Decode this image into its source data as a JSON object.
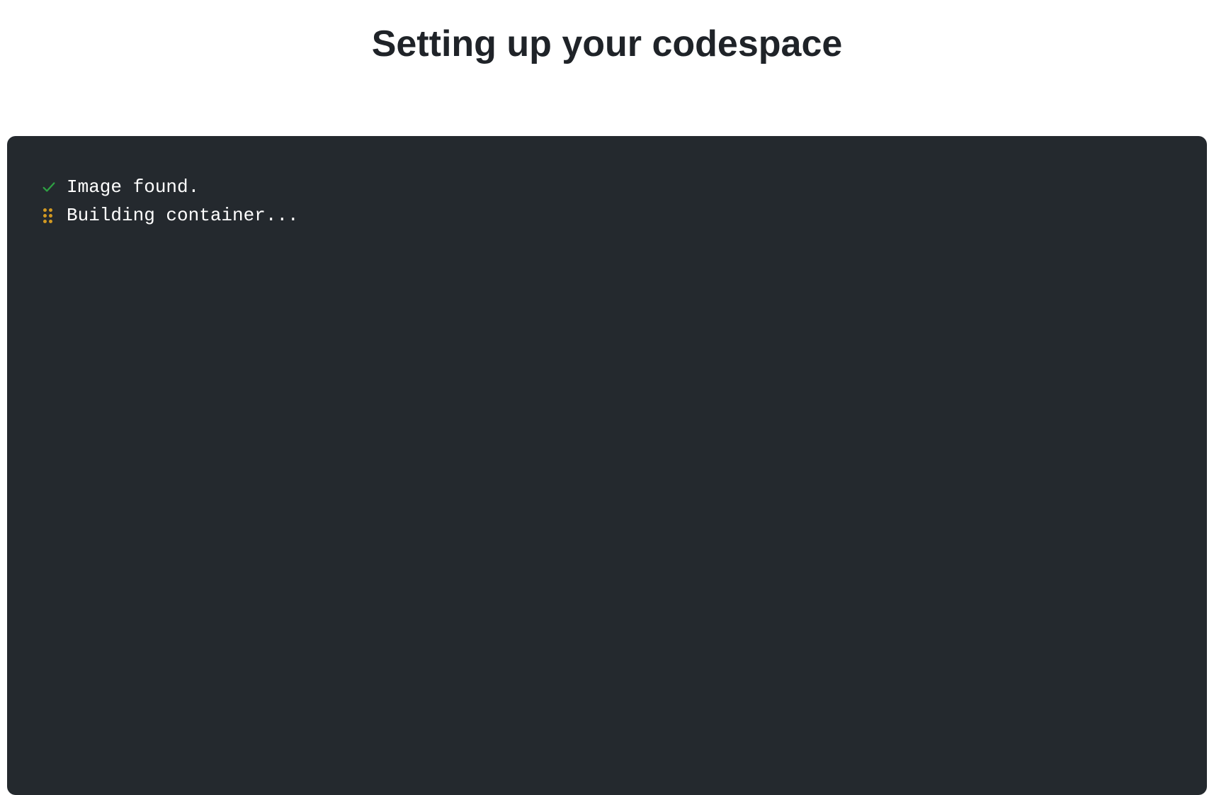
{
  "header": {
    "title": "Setting up your codespace"
  },
  "terminal": {
    "lines": [
      {
        "icon": "checkmark-icon",
        "text": "Image found."
      },
      {
        "icon": "spinner-icon",
        "text": "Building container..."
      }
    ]
  },
  "colors": {
    "success": "#2ea043",
    "pending": "#d29922",
    "terminal_bg": "#24292e",
    "text": "#ffffff"
  }
}
